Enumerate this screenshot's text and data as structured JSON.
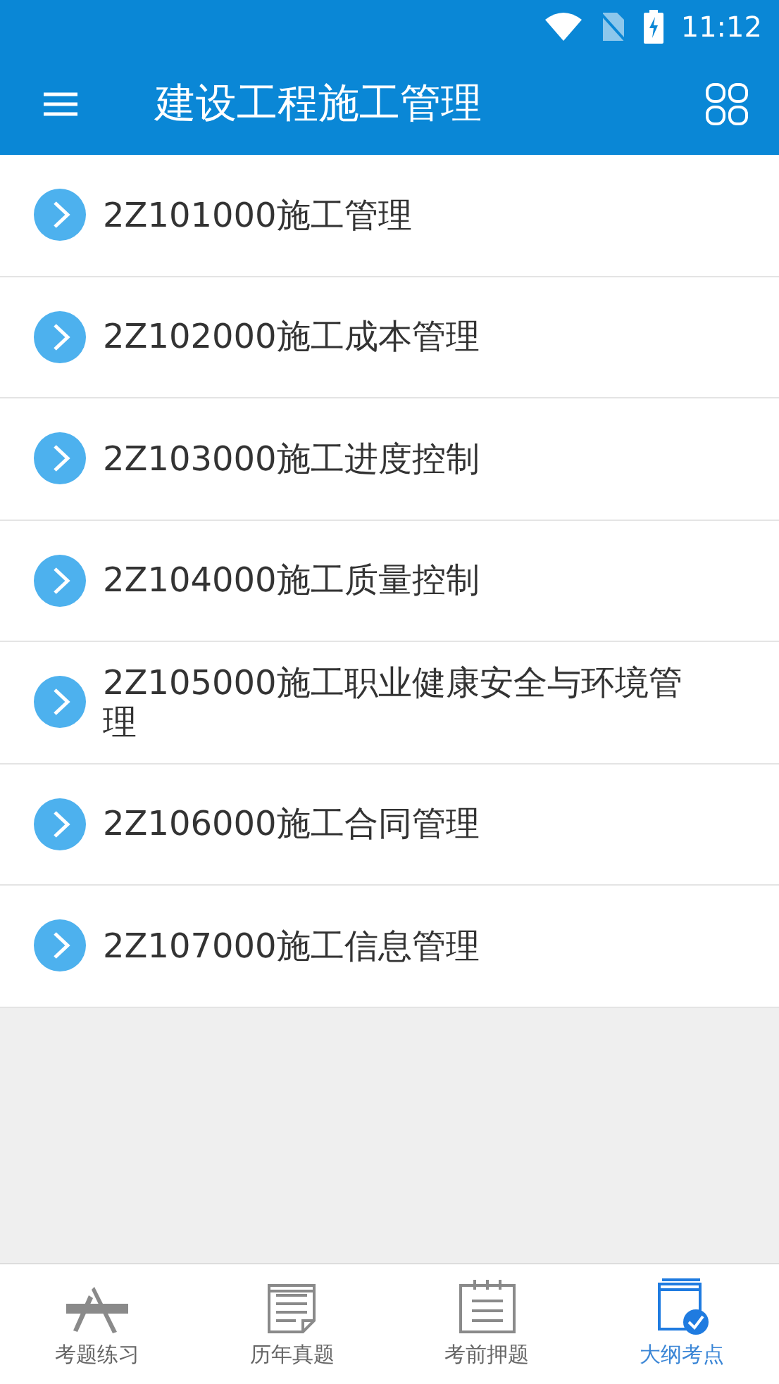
{
  "status_bar": {
    "time": "11:12"
  },
  "app_bar": {
    "title": "建设工程施工管理"
  },
  "chapters": [
    {
      "label": "2Z101000施工管理"
    },
    {
      "label": "2Z102000施工成本管理"
    },
    {
      "label": "2Z103000施工进度控制"
    },
    {
      "label": "2Z104000施工质量控制"
    },
    {
      "label": "2Z105000施工职业健康安全与环境管理"
    },
    {
      "label": "2Z106000施工合同管理"
    },
    {
      "label": "2Z107000施工信息管理"
    }
  ],
  "bottom_nav": [
    {
      "label": "考题练习",
      "kind": "tools",
      "selected": false
    },
    {
      "label": "历年真题",
      "kind": "paper",
      "selected": false
    },
    {
      "label": "考前押题",
      "kind": "notepad",
      "selected": false
    },
    {
      "label": "大纲考点",
      "kind": "book",
      "selected": true
    }
  ]
}
